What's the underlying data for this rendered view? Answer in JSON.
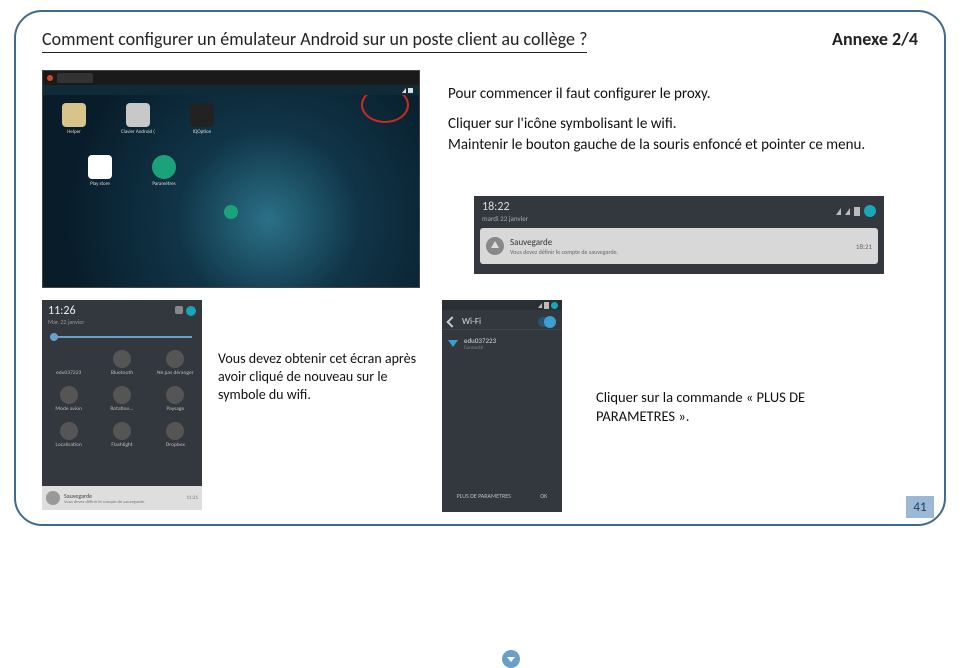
{
  "header": {
    "title": "Comment configurer un émulateur Android sur un poste client au collège ?",
    "annex": "Annexe 2/4"
  },
  "page_number": "41",
  "text": {
    "intro": "Pour commencer il faut configurer le proxy.",
    "click_wifi": "Cliquer sur l'icône symbolisant le wifi.",
    "hold_left": "Maintenir le bouton gauche de la souris enfoncé et pointer ce menu.",
    "mid_block": "Vous devez obtenir cet écran après avoir cliqué de nouveau sur le symbole du wifi.",
    "right_block": "Cliquer sur la commande « PLUS DE PARAMETRES »."
  },
  "emulator": {
    "apps": {
      "helper": "Helper",
      "keyboard": "Clavier Android (AOSP)",
      "iqoption": "IQOption",
      "play": "Play store",
      "settings": "Paramètres"
    }
  },
  "notif": {
    "time": "18:22",
    "date": "mardi 22 janvier",
    "card_title": "Sauvegarde",
    "card_sub": "Vous devez définir le compte de sauvegarde.",
    "card_time": "18:21"
  },
  "qs": {
    "time": "11:26",
    "date": "Mar. 22 janvier",
    "tiles": {
      "wifi": "edu037223",
      "bluetooth": "Bluetooth",
      "dnd": "Ne pas déranger",
      "airplane": "Mode avion",
      "rotation": "Rotation...",
      "landscape": "Paysage",
      "location": "Localisation",
      "flashlight": "Flashlight",
      "dropbox": "Dropbox"
    },
    "footer_title": "Sauvegarde",
    "footer_sub": "Vous devez définir le compte de sauvegarde.",
    "footer_time": "11:21"
  },
  "wifi": {
    "title": "Wi-Fi",
    "network": "edu037223",
    "status": "Connecté",
    "more": "PLUS DE PARAMETRES",
    "ok": "OK"
  }
}
